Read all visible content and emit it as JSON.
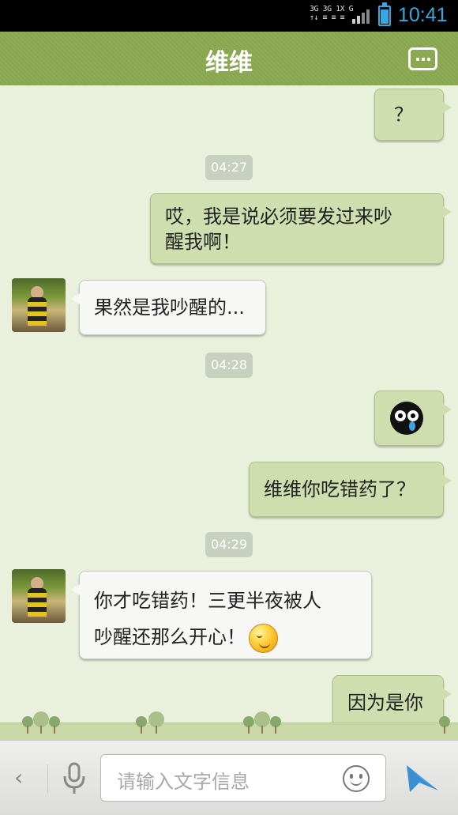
{
  "status_bar": {
    "network_text": "3G 3G 1X G",
    "time": "10:41",
    "battery_color": "#36a8e0"
  },
  "header": {
    "title": "维维",
    "menu_icon": "more-dots-icon",
    "background": "#88a650"
  },
  "messages": [
    {
      "side": "right",
      "type": "text",
      "text": "？"
    },
    {
      "type": "timestamp",
      "text": "04:27"
    },
    {
      "side": "right",
      "type": "text",
      "lines": [
        "哎，我是说必须要发过来吵",
        "醒我啊！"
      ]
    },
    {
      "side": "left",
      "type": "text",
      "text": "果然是我吵醒的..."
    },
    {
      "type": "timestamp",
      "text": "04:28"
    },
    {
      "side": "right",
      "type": "sticker",
      "sticker": "crying-owl-icon"
    },
    {
      "side": "right",
      "type": "text",
      "text": "维维你吃错药了？"
    },
    {
      "type": "timestamp",
      "text": "04:29"
    },
    {
      "side": "left",
      "type": "text",
      "lines": [
        "你才吃错药！三更半夜被人",
        "吵醒还那么开心！"
      ],
      "emoji": "wink-emoji-icon"
    },
    {
      "side": "right",
      "type": "text",
      "text": "因为是你"
    }
  ],
  "input_bar": {
    "back_icon": "chevron-left-icon",
    "voice_icon": "microphone-icon",
    "placeholder": "请输入文字信息",
    "emoji_icon": "smiley-icon",
    "send_icon": "send-arrow-icon",
    "send_color": "#3a8fd0"
  }
}
